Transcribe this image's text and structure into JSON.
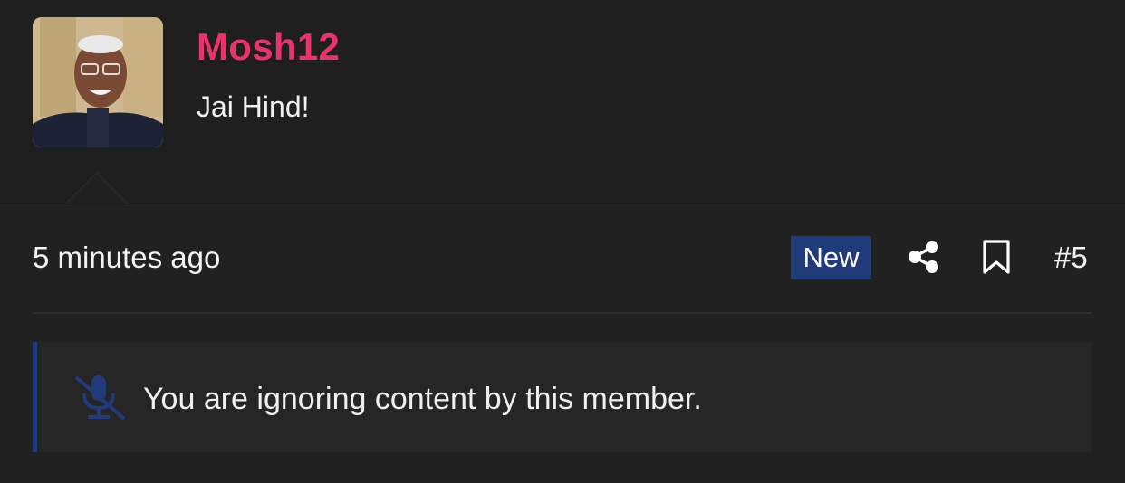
{
  "post": {
    "username": "Mosh12",
    "user_title": "Jai Hind!",
    "timestamp": "5 minutes ago",
    "new_badge": "New",
    "post_number": "#5",
    "avatar_icon": "user-avatar-photo",
    "share_icon": "share-icon",
    "bookmark_icon": "bookmark-icon"
  },
  "ignored_notice": {
    "text": "You are ignoring content by this member.",
    "icon": "microphone-slash-icon"
  },
  "colors": {
    "username": "#e8336d",
    "badge_bg": "#213a7a",
    "accent_border": "#213a7a",
    "background": "#212121"
  }
}
